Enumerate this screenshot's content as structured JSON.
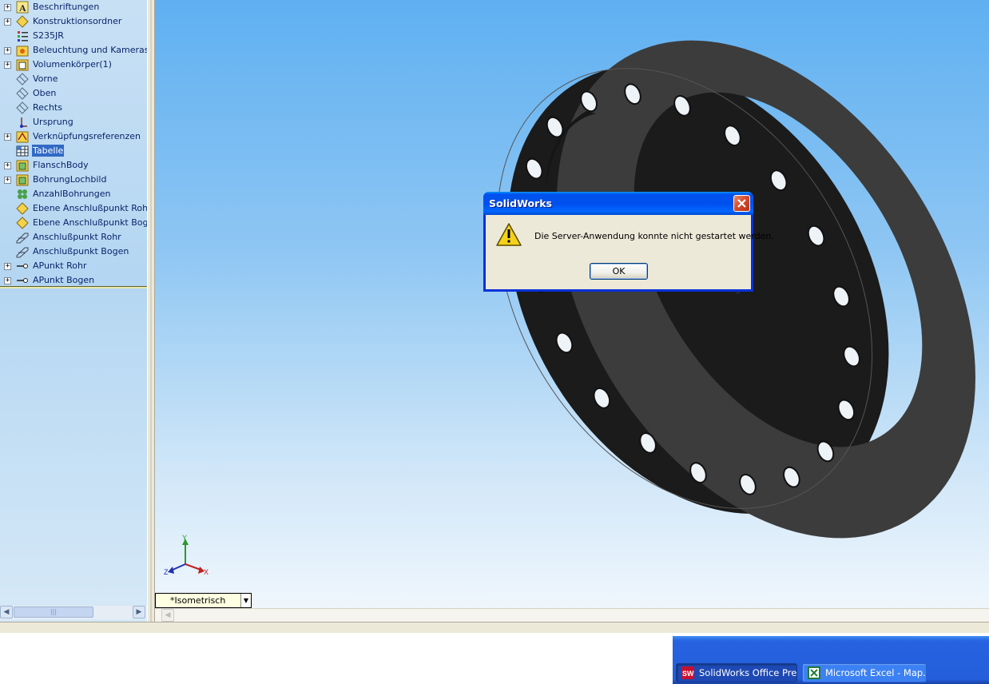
{
  "feature_tree": {
    "items": [
      {
        "label": "Beschriftungen",
        "expandable": true,
        "icon": "annotations-icon"
      },
      {
        "label": "Konstruktionsordner",
        "expandable": true,
        "icon": "design-binder-icon"
      },
      {
        "label": "S235JR",
        "expandable": false,
        "icon": "material-icon"
      },
      {
        "label": "Beleuchtung und Kameras",
        "expandable": true,
        "icon": "lights-cameras-icon"
      },
      {
        "label": "Volumenkörper(1)",
        "expandable": true,
        "icon": "solid-bodies-icon"
      },
      {
        "label": "Vorne",
        "expandable": false,
        "icon": "plane-icon"
      },
      {
        "label": "Oben",
        "expandable": false,
        "icon": "plane-icon"
      },
      {
        "label": "Rechts",
        "expandable": false,
        "icon": "plane-icon"
      },
      {
        "label": "Ursprung",
        "expandable": false,
        "icon": "origin-icon"
      },
      {
        "label": "Verknüpfungsreferenzen",
        "expandable": true,
        "icon": "mate-references-icon"
      },
      {
        "label": "Tabelle",
        "expandable": false,
        "icon": "design-table-icon",
        "selected": true
      },
      {
        "label": "FlanschBody",
        "expandable": true,
        "icon": "feature-icon"
      },
      {
        "label": "BohrungLochbild",
        "expandable": true,
        "icon": "feature-icon"
      },
      {
        "label": "AnzahlBohrungen",
        "expandable": false,
        "icon": "pattern-icon"
      },
      {
        "label": "Ebene Anschlußpunkt Rohr",
        "expandable": false,
        "icon": "ref-plane-icon"
      },
      {
        "label": "Ebene Anschlußpunkt Bogen",
        "expandable": false,
        "icon": "ref-plane-icon"
      },
      {
        "label": "Anschlußpunkt Rohr",
        "expandable": false,
        "icon": "sketch-icon"
      },
      {
        "label": "Anschlußpunkt Bogen",
        "expandable": false,
        "icon": "sketch-icon"
      },
      {
        "label": "APunkt Rohr",
        "expandable": true,
        "icon": "connection-point-icon"
      },
      {
        "label": "APunkt Bogen",
        "expandable": true,
        "icon": "connection-point-icon"
      }
    ]
  },
  "viewport": {
    "view_orientation": "*Isometrisch",
    "ghost_label": "APunkt Bogen",
    "triad": {
      "x": "X",
      "y": "Y",
      "z": "Z"
    },
    "part_color": "#3c3c3c",
    "background_top": "#5fb0f2",
    "background_bottom": "#f2f8fd"
  },
  "dialog": {
    "title": "SolidWorks",
    "message": "Die Server-Anwendung konnte nicht gestartet werden.",
    "ok_label": "OK",
    "icon": "warning-icon"
  },
  "taskbar": {
    "buttons": [
      {
        "label": "SolidWorks Office Pre...",
        "icon": "solidworks-icon",
        "active": true
      },
      {
        "label": "Microsoft Excel - Map...",
        "icon": "excel-icon",
        "active": false
      }
    ]
  }
}
